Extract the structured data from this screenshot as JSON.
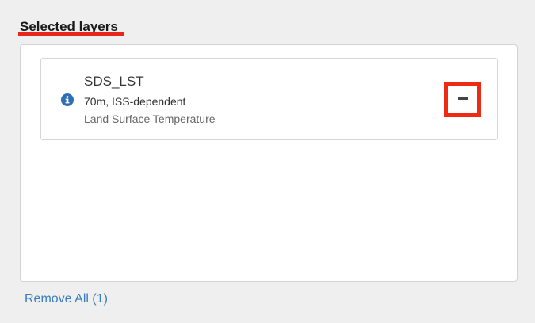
{
  "section": {
    "title": "Selected layers"
  },
  "layers": [
    {
      "name": "SDS_LST",
      "resolution": "70m, ISS-dependent",
      "description": "Land Surface Temperature",
      "info_icon": "info-circle-icon",
      "remove_icon": "minus-icon"
    }
  ],
  "footer": {
    "remove_all_label": "Remove All (1)"
  },
  "colors": {
    "highlight": "#ee2a13",
    "underline": "#e8261d",
    "link": "#3a7dbd",
    "info_icon": "#2f6eb5"
  }
}
